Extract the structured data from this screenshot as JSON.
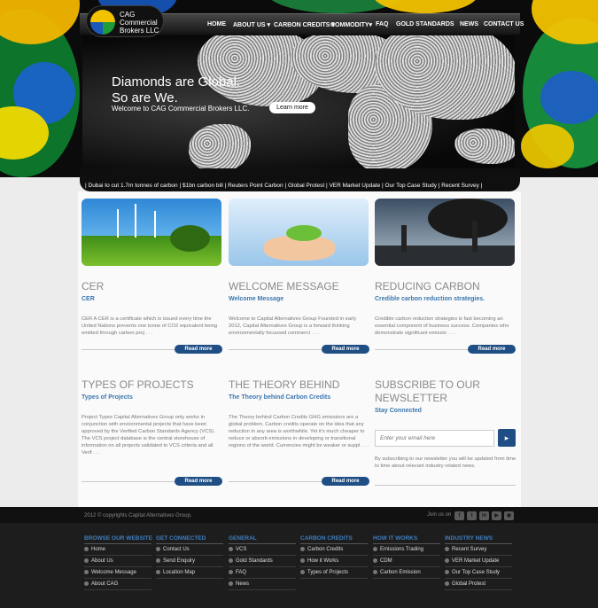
{
  "logo": {
    "line1": "CAG",
    "line2": "Commercial",
    "line3": "Brokers LLC"
  },
  "nav": [
    "HOME",
    "ABOUT US ▾",
    "CARBON CREDITS ▾",
    "COMMODITY▾",
    "FAQ",
    "GOLD STANDARDS",
    "NEWS",
    "CONTACT US"
  ],
  "hero": {
    "line1": "Diamonds are Global.",
    "line2": "So are We.",
    "subtitle": "Welcome to CAG Commercial Brokers LLC.",
    "button": "Learn more"
  },
  "ticker": "| Dubai to cut 1.7m tonnes of carbon | $1bn carbon bill | Reuters Point Carbon | Global Protest | VER Market Update | Our Top Case Study | Recent Survey |",
  "columns": [
    {
      "heading": "CER",
      "subheading": "CER",
      "body": "CER A CER is a certificate which is issued every time the United Nations prevents one tonne of CO2 equivalent being emitted through carbon proj . . .",
      "button": "Read more"
    },
    {
      "heading": "WELCOME MESSAGE",
      "subheading": "Welcome Message",
      "body": "Welcome to Capital Alternatives Group Founded in early 2012, Capital Alternatives Group is a forward thinking environmentally focussed commerci . . .",
      "button": "Read more"
    },
    {
      "heading": "REDUCING CARBON",
      "subheading": "Credible carbon reduction strategies.",
      "body": "Credible carbon reduction strategies is fast becoming an essential component of business success. Companies who demonstrate significant emissio . . .",
      "button": "Read more"
    },
    {
      "heading": "TYPES OF PROJECTS",
      "subheading": "Types of Projects",
      "body": "Project Types Capital Alternatives Group only works in conjunction with environmental projects that have been approved by the Verified Carbon Standards Agency (VCS). The VCS project database is the central storehouse of information on all projects validated to VCS criteria and all Verif . . .",
      "button": "Read more"
    },
    {
      "heading": "THE THEORY BEHIND",
      "subheading": "The Theory behind Carbon Credits",
      "body": "The Theory behind Carbon Credits GHG emissions are a global problem. Carbon credits operate on the idea that any reduction in any area is worthwhile. Yet it's much cheaper to reduce or absorb emissions in developing or transitional regions of the world. Currencies might be weaker or suppl . . .",
      "button": "Read more"
    }
  ],
  "newsletter": {
    "heading1": "SUBSCRIBE TO OUR",
    "heading2": "NEWSLETTER",
    "subheading": "Stay Connected",
    "placeholder": "Enter your email here",
    "body": "By subscribing to our newsletter you will be updated from time to time about relevant industry related news."
  },
  "footer": {
    "copyright": "2012 © copyrights Capital Alternatives Group.",
    "join": "Join us on",
    "columns": [
      {
        "title": "BROWSE OUR WEBSITE",
        "items": [
          "Home",
          "About Us",
          "Welcome Message",
          "About CAG"
        ]
      },
      {
        "title": "GET CONNECTED",
        "items": [
          "Contact Us",
          "Send Enquiry",
          "Location Map"
        ]
      },
      {
        "title": "GENERAL",
        "items": [
          "VCS",
          "Gold Standards",
          "FAQ",
          "News"
        ]
      },
      {
        "title": "CARBON CREDITS",
        "items": [
          "Carbon Credits",
          "How it Works",
          "Types of Projects"
        ]
      },
      {
        "title": "HOW IT WORKS",
        "items": [
          "Emissions Trading",
          "CDM",
          "Carbon Emission"
        ]
      },
      {
        "title": "INDUSTRY NEWS",
        "items": [
          "Recent Survey",
          "VER Market Update",
          "Our Top Case Study",
          "Global Protest"
        ]
      }
    ]
  },
  "icons": {
    "social": [
      "facebook-icon",
      "twitter-icon",
      "linkedin-icon",
      "youtube-icon",
      "rss-icon"
    ],
    "go": "arrow-right-icon"
  },
  "colors": {
    "accent": "#1e4e84",
    "link": "#3b77b0",
    "footer_heading": "#3e7fc1"
  }
}
